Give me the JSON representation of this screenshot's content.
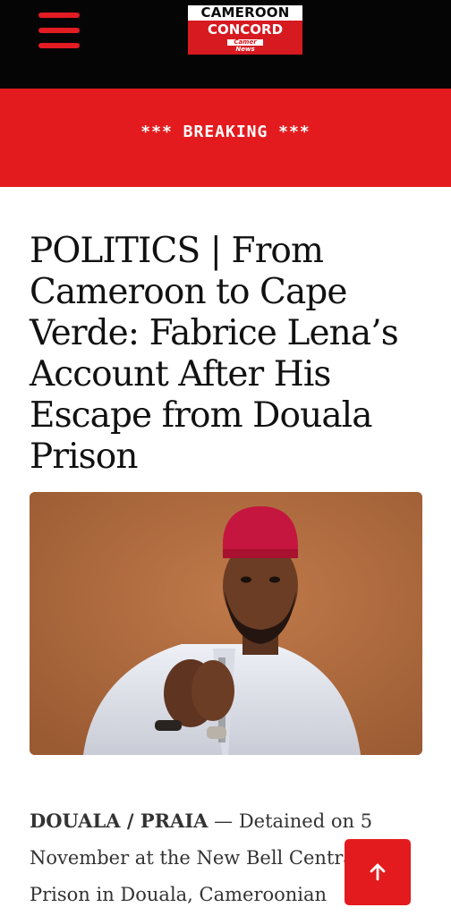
{
  "header": {
    "menu_icon": "hamburger-menu-icon",
    "logo": {
      "line1": "CAMEROON",
      "line2": "CONCORD",
      "badge_top": "Camer",
      "badge_bottom": "News"
    }
  },
  "breaking": {
    "label": "*** BREAKING ***"
  },
  "article": {
    "headline": "POLITICS | From Cameroon to Cape Verde: Fabrice Lena’s Account After His Escape from Douala Prison",
    "dateline": "DOUALA / PRAIA",
    "body": " — Detained on 5 November at the New Bell Central Prison in Douala, Cameroonian"
  },
  "scroll_top": {
    "icon": "arrow-up-icon"
  },
  "colors": {
    "brand_red": "#e41b1e",
    "topbar_black": "#050505",
    "text_dark": "#111111"
  }
}
